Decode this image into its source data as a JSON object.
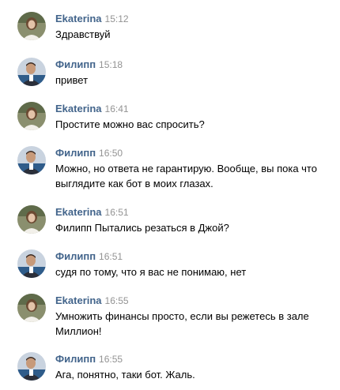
{
  "messages": [
    {
      "author": "Ekaterina",
      "time": "15:12",
      "text": "Здравствуй",
      "avatar": "avatar-ekaterina"
    },
    {
      "author": "Филипп",
      "time": "15:18",
      "text": "привет",
      "avatar": "avatar-filipp"
    },
    {
      "author": "Ekaterina",
      "time": "16:41",
      "text": "Простите можно вас спросить?",
      "avatar": "avatar-ekaterina"
    },
    {
      "author": "Филипп",
      "time": "16:50",
      "text": "Можно, но ответа не гарантирую. Вообще, вы пока что выглядите как бот в моих глазах.",
      "avatar": "avatar-filipp"
    },
    {
      "author": "Ekaterina",
      "time": "16:51",
      "text": "Филипп Пытались резаться в Джой?",
      "avatar": "avatar-ekaterina"
    },
    {
      "author": "Филипп",
      "time": "16:51",
      "text": "судя по тому, что я вас не понимаю, нет",
      "avatar": "avatar-filipp"
    },
    {
      "author": "Ekaterina",
      "time": "16:55",
      "text": "Умножить финансы просто, если вы режетесь в зале Миллион!",
      "avatar": "avatar-ekaterina"
    },
    {
      "author": "Филипп",
      "time": "16:55",
      "text": "Ага, понятно, таки бот. Жаль.",
      "avatar": "avatar-filipp"
    }
  ],
  "colors": {
    "author": "#42648b",
    "time": "#939393",
    "text": "#000000",
    "background": "#ffffff"
  }
}
